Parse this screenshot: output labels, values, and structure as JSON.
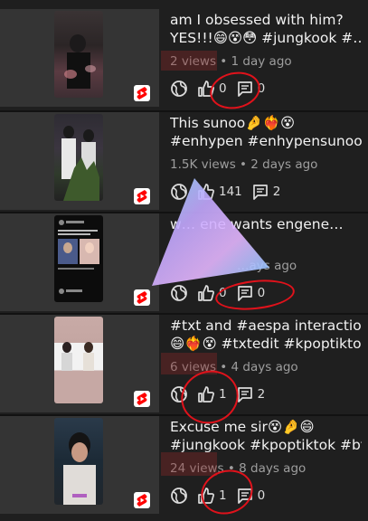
{
  "videos": [
    {
      "title_line1": "am I obsessed with him?",
      "title_line2": "YES!!!😄😵😳 #jungkook #…",
      "meta": "2 views • 1 day ago",
      "likes": "0",
      "comments": "0"
    },
    {
      "title_line1": "This sunoo🤌❤️‍🔥😵",
      "title_line2": "#enhypen #enhypensunoo …",
      "meta": "1.5K views • 2 days ago",
      "likes": "141",
      "comments": "2"
    },
    {
      "title_line1": "w…      ene wants engene…",
      "title_line2": "",
      "meta": "…ays ago",
      "likes": "0",
      "comments": "0"
    },
    {
      "title_line1": "#txt and  #aespa interaction",
      "title_line2": "😄❤️‍🔥😵 #txtedit #kpoptiktok…",
      "meta": "6 views • 4 days ago",
      "likes": "1",
      "comments": "2"
    },
    {
      "title_line1": "Excuse me sir😵🤌😄",
      "title_line2": "#jungkook #kpoptiktok #bt…",
      "meta": "24 views • 8 days ago",
      "likes": "1",
      "comments": "0"
    }
  ],
  "icons": {
    "visibility": "public-globe-icon",
    "like": "thumbs-up-icon",
    "comment": "comment-icon",
    "shorts": "shorts-badge-icon"
  },
  "colors": {
    "background": "#1f1f1f",
    "annotation": "#e0121b",
    "shorts": "#ff0000"
  }
}
